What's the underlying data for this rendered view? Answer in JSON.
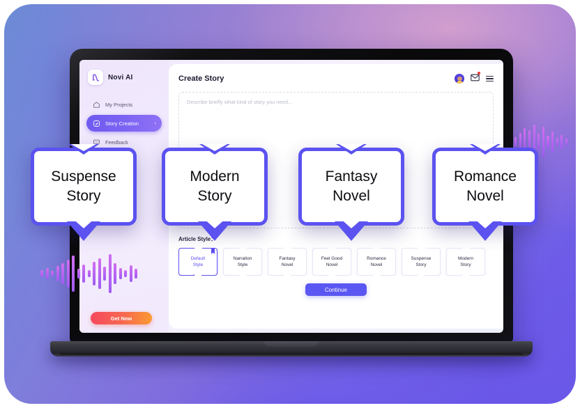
{
  "app": {
    "brand_name": "Novi AI",
    "logo_icon": "novi-logo-icon"
  },
  "sidebar": {
    "items": [
      {
        "label": "My Projects",
        "icon": "home-icon",
        "active": false
      },
      {
        "label": "Story Creation",
        "icon": "edit-icon",
        "active": true,
        "chevron": "›"
      },
      {
        "label": "Feedback",
        "icon": "chat-icon",
        "active": false
      }
    ],
    "cta": {
      "label": "Get Now"
    }
  },
  "header": {
    "title": "Create Story",
    "icons": [
      {
        "name": "avatar"
      },
      {
        "name": "mail-icon",
        "badge": true
      },
      {
        "name": "menu-icon"
      }
    ]
  },
  "prompt": {
    "placeholder": "Describe briefly what kind of story you need..."
  },
  "article_style": {
    "label": "Article Style：",
    "options": [
      {
        "label_top": "Default",
        "label_bottom": "Style",
        "selected": true
      },
      {
        "label_top": "Narration",
        "label_bottom": "Style",
        "selected": false
      },
      {
        "label_top": "Fantasy",
        "label_bottom": "Novel",
        "selected": false
      },
      {
        "label_top": "Feel Good",
        "label_bottom": "Novel",
        "selected": false
      },
      {
        "label_top": "Romance",
        "label_bottom": "Novel",
        "selected": false
      },
      {
        "label_top": "Suspense",
        "label_bottom": "Story",
        "selected": false
      },
      {
        "label_top": "Modern",
        "label_bottom": "Story",
        "selected": false
      }
    ]
  },
  "actions": {
    "continue_label": "Continue"
  },
  "callouts": [
    {
      "line1": "Suspense",
      "line2": "Story"
    },
    {
      "line1": "Modern",
      "line2": "Story"
    },
    {
      "line1": "Fantasy",
      "line2": "Novel"
    },
    {
      "line1": "Romance",
      "line2": "Novel"
    }
  ],
  "colors": {
    "accent_blue": "#5b52f0",
    "accent_purple": "#7b63f3",
    "cta_orange": "#f76a4f",
    "badge_red": "#f2372f",
    "wave_pink": "#d06ff0"
  },
  "decor": {
    "wave_left_bars": [
      10,
      16,
      8,
      22,
      30,
      40,
      52,
      14,
      26,
      10,
      34,
      44,
      20,
      56,
      30,
      16,
      10,
      24,
      14
    ],
    "wave_right_bars": [
      14,
      26,
      40,
      34,
      50,
      24,
      44,
      18,
      30,
      12,
      20,
      10
    ]
  }
}
